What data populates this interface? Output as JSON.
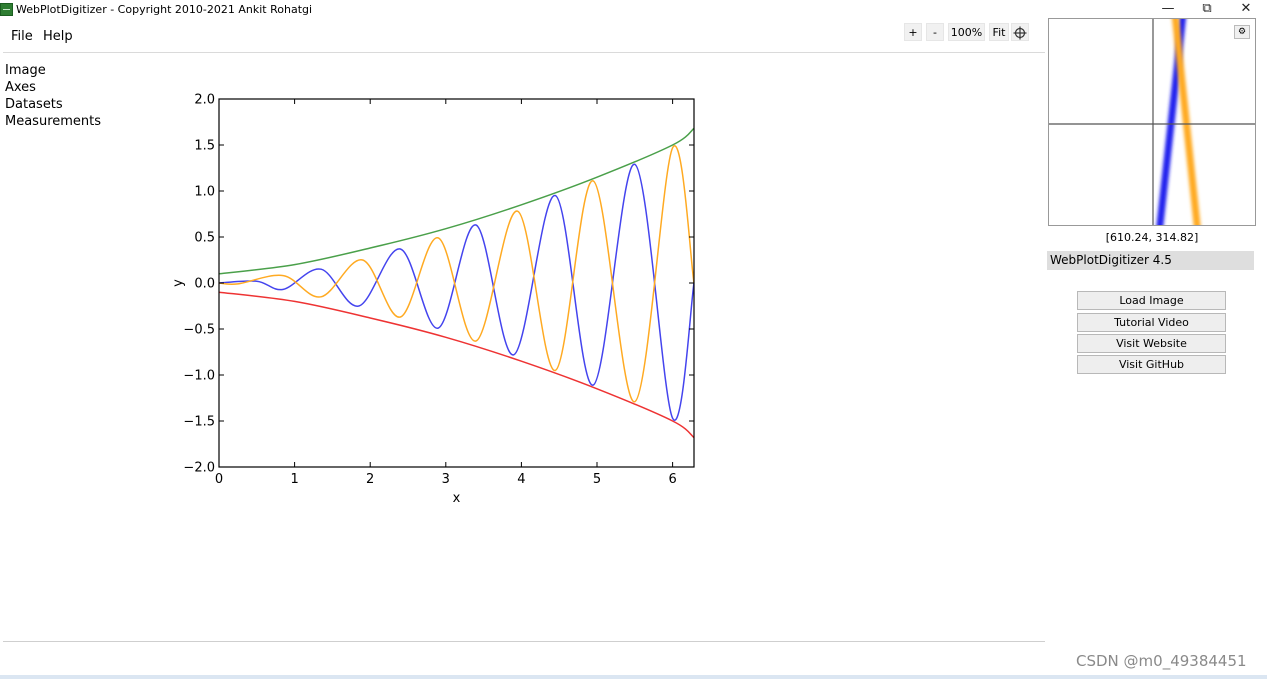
{
  "window": {
    "title": "WebPlotDigitizer - Copyright 2010-2021 Ankit Rohatgi",
    "controls": {
      "minimize": "—",
      "restore": "⧉",
      "close": "✕"
    }
  },
  "menu": {
    "items": [
      "File",
      "Help"
    ]
  },
  "toolbar": {
    "zoom_in": "+",
    "zoom_out": "-",
    "zoom_level": "100%",
    "fit": "Fit",
    "crosshair_icon": "crosshair-icon"
  },
  "sidebar": {
    "items": [
      "Image",
      "Axes",
      "Datasets",
      "Measurements"
    ]
  },
  "zoom_panel": {
    "coordinates": "[610.24, 314.82]",
    "settings_icon": "settings-icon"
  },
  "info": {
    "version": "WebPlotDigitizer 4.5"
  },
  "actions": {
    "buttons": [
      "Load Image",
      "Tutorial Video",
      "Visit Website",
      "Visit GitHub"
    ]
  },
  "watermark": "CSDN @m0_49384451",
  "chart_data": {
    "type": "line",
    "xlabel": "x",
    "ylabel": "y",
    "xlim": [
      0,
      6.283
    ],
    "ylim": [
      -2.0,
      2.0
    ],
    "xticks": [
      0,
      1,
      2,
      3,
      4,
      5,
      6
    ],
    "yticks": [
      2.0,
      1.5,
      1.0,
      0.5,
      0.0,
      -0.5,
      -1.0,
      -1.5,
      -2.0
    ],
    "ytick_labels": [
      "2.0",
      "1.5",
      "1.0",
      "0.5",
      "0.0",
      "−0.5",
      "−1.0",
      "−1.5",
      "−2.0"
    ],
    "grid": false,
    "legend": false,
    "series": [
      {
        "color": "#4444ee",
        "x": [
          0,
          0.5,
          0.85,
          1.35,
          1.85,
          2.4,
          2.9,
          3.4,
          3.9,
          4.45,
          4.95,
          5.5,
          6.0,
          6.283
        ],
        "values": [
          0,
          0.02,
          -0.07,
          0.15,
          -0.25,
          0.37,
          -0.49,
          0.63,
          -0.78,
          0.95,
          -1.11,
          1.29,
          -1.47,
          0
        ]
      },
      {
        "color": "#ffaa22",
        "x": [
          0,
          0.25,
          0.85,
          1.35,
          1.9,
          2.4,
          2.9,
          3.4,
          3.95,
          4.45,
          4.95,
          5.5,
          6.0,
          6.283
        ],
        "values": [
          0,
          -0.01,
          0.08,
          -0.15,
          0.25,
          -0.37,
          0.49,
          -0.63,
          0.78,
          -0.95,
          1.11,
          -1.29,
          1.47,
          0
        ]
      },
      {
        "color": "#4aa04a",
        "x": [
          0,
          1,
          2,
          3,
          4,
          5,
          6,
          6.283
        ],
        "values": [
          0.1,
          0.2,
          0.38,
          0.59,
          0.85,
          1.15,
          1.5,
          1.68
        ]
      },
      {
        "color": "#ee3333",
        "x": [
          0,
          1,
          2,
          3,
          4,
          5,
          6,
          6.283
        ],
        "values": [
          -0.1,
          -0.2,
          -0.38,
          -0.59,
          -0.85,
          -1.15,
          -1.5,
          -1.68
        ]
      }
    ]
  }
}
